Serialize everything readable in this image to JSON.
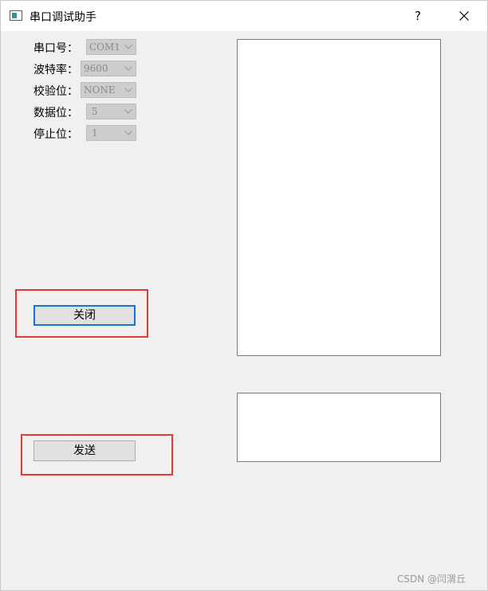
{
  "window": {
    "title": "串口调试助手",
    "help_label": "?",
    "app_icon": "app-window-icon",
    "close_icon": "close-icon"
  },
  "settings": [
    {
      "label": "串口号：",
      "value": "COM1"
    },
    {
      "label": "波特率：",
      "value": "9600"
    },
    {
      "label": "校验位：",
      "value": "NONE"
    },
    {
      "label": "数据位：",
      "value": "5"
    },
    {
      "label": "停止位：",
      "value": "1"
    }
  ],
  "buttons": {
    "close_label": "关闭",
    "send_label": "发送"
  },
  "receive_area": {
    "value": ""
  },
  "send_area": {
    "value": ""
  },
  "watermark": "CSDN @闫渭丘",
  "colors": {
    "highlight_box": "#e53935",
    "focus_border": "#1673d4",
    "window_bg": "#f0f0f0"
  }
}
